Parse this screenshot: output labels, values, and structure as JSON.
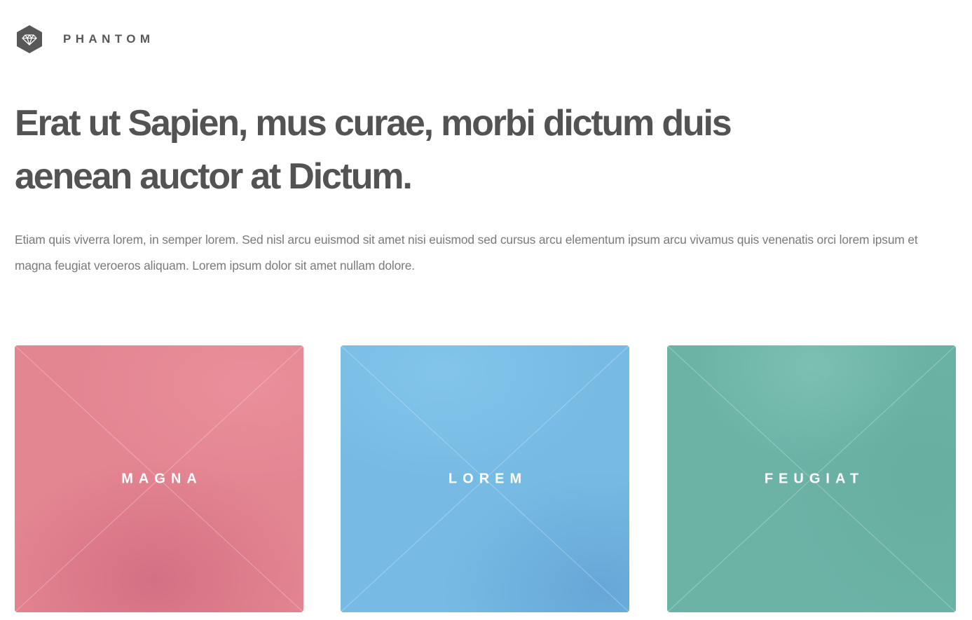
{
  "header": {
    "brand": "PHANTOM",
    "logo_icon": "diamond-hexagon-icon"
  },
  "hero": {
    "title_line1": "Erat ut Sapien, mus curae, morbi dictum duis",
    "title_line2": "aenean auctor at Dictum.",
    "intro": "Etiam quis viverra lorem, in semper lorem. Sed nisl arcu euismod sit amet nisi euismod sed cursus arcu elementum ipsum arcu vivamus quis venenatis orci lorem ipsum et magna feugiat veroeros aliquam. Lorem ipsum dolor sit amet nullam dolore."
  },
  "tiles": [
    {
      "label": "MAGNA",
      "color": "#e48592"
    },
    {
      "label": "LOREM",
      "color": "#77bbe4"
    },
    {
      "label": "FEUGIAT",
      "color": "#6cb3a6"
    }
  ],
  "colors": {
    "text_dark": "#535353",
    "text_body": "#7a7a7a",
    "logo_fill": "#585858"
  }
}
